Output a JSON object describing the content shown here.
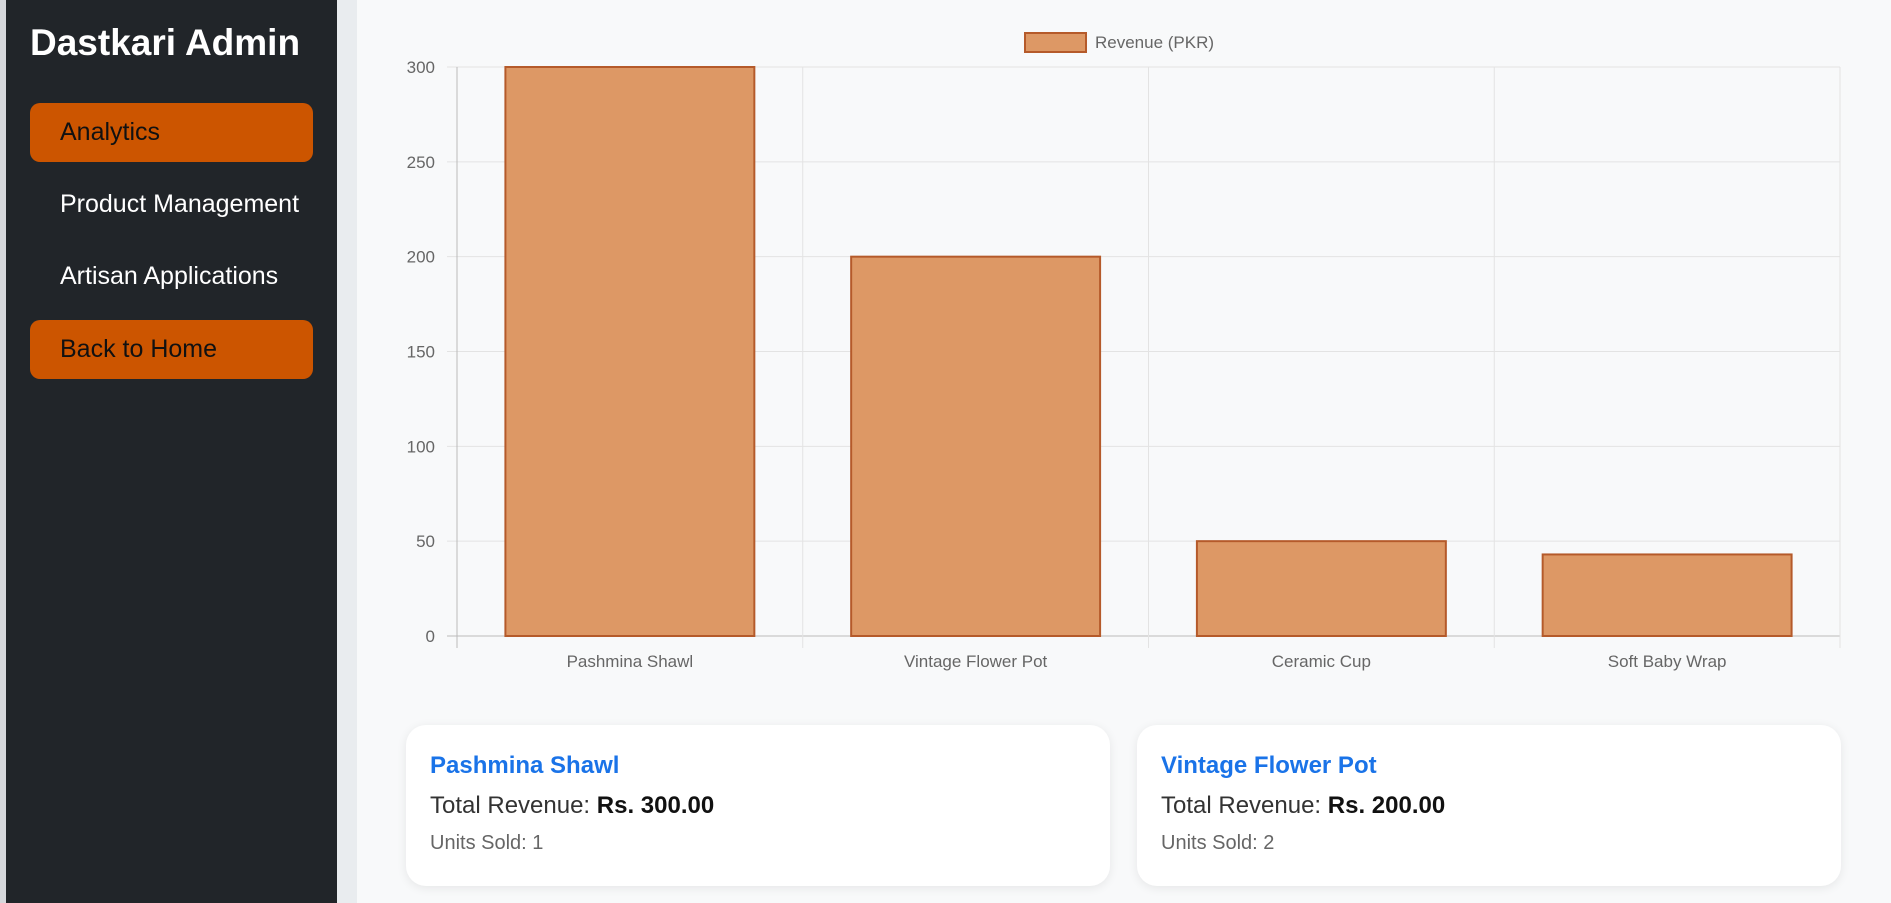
{
  "sidebar": {
    "brand": "Dastkari Admin",
    "items": [
      {
        "label": "Analytics",
        "active": true
      },
      {
        "label": "Product Management",
        "active": false
      },
      {
        "label": "Artisan Applications",
        "active": false
      },
      {
        "label": "Back to Home",
        "active": true
      }
    ]
  },
  "colors": {
    "sidebar_bg": "#212529",
    "accent": "#cc5500",
    "bar_fill": "#dd9865",
    "bar_border": "#b55a2a",
    "link": "#1a73e8"
  },
  "chart_data": {
    "type": "bar",
    "categories": [
      "Pashmina Shawl",
      "Vintage Flower Pot",
      "Ceramic Cup",
      "Soft Baby Wrap"
    ],
    "series": [
      {
        "name": "Revenue (PKR)",
        "values": [
          300,
          200,
          50,
          43
        ]
      }
    ],
    "yticks": [
      "0",
      "50",
      "100",
      "150",
      "200",
      "250",
      "300"
    ],
    "ylim": [
      0,
      300
    ],
    "grid": true,
    "legend": "top-center"
  },
  "cards": [
    {
      "title": "Pashmina Shawl",
      "revenue_label": "Total Revenue:",
      "revenue_value": "Rs. 300.00",
      "units": "Units Sold: 1"
    },
    {
      "title": "Vintage Flower Pot",
      "revenue_label": "Total Revenue:",
      "revenue_value": "Rs. 200.00",
      "units": "Units Sold: 2"
    }
  ]
}
